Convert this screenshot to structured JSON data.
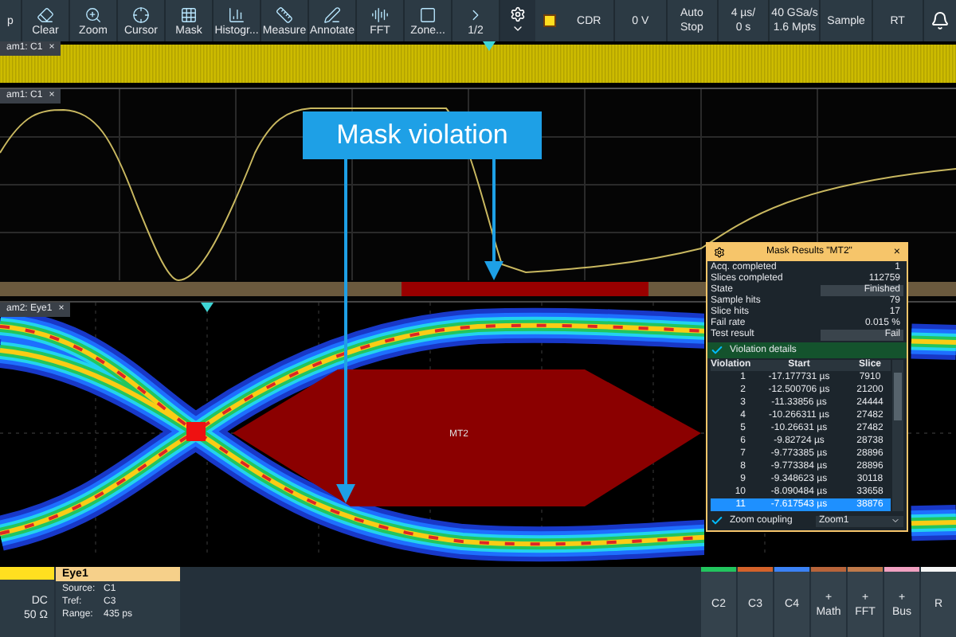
{
  "toolbar": {
    "items": [
      {
        "label": "p"
      },
      {
        "label": "Clear"
      },
      {
        "label": "Zoom"
      },
      {
        "label": "Cursor"
      },
      {
        "label": "Mask"
      },
      {
        "label": "Histogr..."
      },
      {
        "label": "Measure"
      },
      {
        "label": "Annotate"
      },
      {
        "label": "FFT"
      },
      {
        "label": "Zone..."
      },
      {
        "label": "1/2"
      }
    ]
  },
  "status": [
    {
      "top": "CDR"
    },
    {
      "top": "0 V"
    },
    {
      "top": "Auto",
      "bottom": "Stop"
    },
    {
      "top": "4 µs/",
      "bottom": "0 s"
    },
    {
      "top": "40 GSa/s",
      "bottom": "1.6 Mpts"
    },
    {
      "top": "Sample"
    },
    {
      "top": "RT"
    }
  ],
  "strip_tab": {
    "label": "am1: C1",
    "close": "×"
  },
  "waveform_tab": {
    "label": "am1: C1",
    "close": "×"
  },
  "eye_tab": {
    "label": "am2: Eye1",
    "close": "×"
  },
  "callout": {
    "text": "Mask violation"
  },
  "mask": {
    "label": "MT2"
  },
  "mask_results": {
    "title": "Mask Results \"MT2\"",
    "close": "×",
    "stats": [
      {
        "label": "Acq. completed",
        "value": "1",
        "kind": "text"
      },
      {
        "label": "Slices completed",
        "value": "112759",
        "kind": "text"
      },
      {
        "label": "State",
        "value": "Finished",
        "kind": "field"
      },
      {
        "label": "Sample hits",
        "value": "79",
        "kind": "text"
      },
      {
        "label": "Slice hits",
        "value": "17",
        "kind": "text"
      },
      {
        "label": "Fail rate",
        "value": "0.015 %",
        "kind": "text"
      },
      {
        "label": "Test result",
        "value": "Fail",
        "kind": "field"
      }
    ],
    "violation_details": {
      "label": "Violation details",
      "checked": true
    },
    "table": {
      "columns": [
        "Violation",
        "Start",
        "Slice"
      ],
      "rows": [
        {
          "index": "1",
          "start": "-17.177731 µs",
          "slice": "7910",
          "selected": false
        },
        {
          "index": "2",
          "start": "-12.500706 µs",
          "slice": "21200",
          "selected": false
        },
        {
          "index": "3",
          "start": "-11.33856 µs",
          "slice": "24444",
          "selected": false
        },
        {
          "index": "4",
          "start": "-10.266311 µs",
          "slice": "27482",
          "selected": false
        },
        {
          "index": "5",
          "start": "-10.26631 µs",
          "slice": "27482",
          "selected": false
        },
        {
          "index": "6",
          "start": "-9.82724 µs",
          "slice": "28738",
          "selected": false
        },
        {
          "index": "7",
          "start": "-9.773385 µs",
          "slice": "28896",
          "selected": false
        },
        {
          "index": "8",
          "start": "-9.773384 µs",
          "slice": "28896",
          "selected": false
        },
        {
          "index": "9",
          "start": "-9.348623 µs",
          "slice": "30118",
          "selected": false
        },
        {
          "index": "10",
          "start": "-8.090484 µs",
          "slice": "33658",
          "selected": false
        },
        {
          "index": "11",
          "start": "-7.617543 µs",
          "slice": "38876",
          "selected": true
        }
      ]
    },
    "zoom_coupling": {
      "label": "Zoom coupling",
      "checked": true
    },
    "zoom_select": {
      "value": "Zoom1"
    }
  },
  "channel_panel": {
    "coupling": "DC",
    "impedance": "50 Ω"
  },
  "eye_panel": {
    "title": "Eye1",
    "props": [
      {
        "label": "Source:",
        "value": "C1"
      },
      {
        "label": "Tref:",
        "value": "C3"
      },
      {
        "label": "Range:",
        "value": "435 ps"
      }
    ]
  },
  "source_buttons": [
    {
      "label": "C2",
      "color": "#22c55e"
    },
    {
      "label": "C3",
      "color": "#d4622a"
    },
    {
      "label": "C4",
      "color": "#3b82f6"
    },
    {
      "plus": "+",
      "label": "Math",
      "color": "#b8643a"
    },
    {
      "plus": "+",
      "label": "FFT",
      "color": "#c07a4a"
    },
    {
      "plus": "+",
      "label": "Bus",
      "color": "#f0a0c0"
    },
    {
      "label": "R",
      "color": "#f5f5f5"
    }
  ]
}
